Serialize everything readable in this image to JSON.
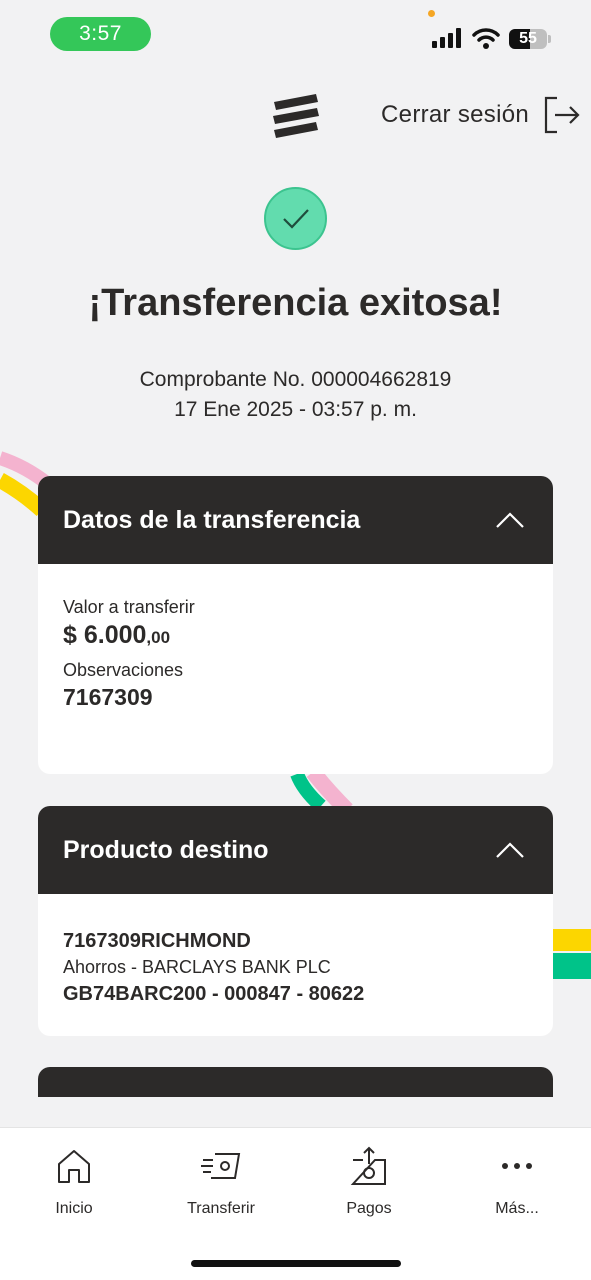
{
  "status_bar": {
    "time": "3:57",
    "battery": "55",
    "battery_fraction": 0.55
  },
  "header": {
    "logout_label": "Cerrar sesión"
  },
  "success": {
    "title": "¡Transferencia exitosa!",
    "voucher": "Comprobante No. 000004662819",
    "datetime": "17 Ene 2025 - 03:57 p. m."
  },
  "transfer_card": {
    "title": "Datos de la transferencia",
    "amount_label": "Valor a transferir",
    "amount_main": "$ 6.000",
    "amount_cents": ",00",
    "notes_label": "Observaciones",
    "notes_value": "7167309"
  },
  "destination_card": {
    "title": "Producto destino",
    "name": "7167309RICHMOND",
    "account_type": "Ahorros - BARCLAYS BANK PLC",
    "account_number": "GB74BARC200 - 000847 - 80622"
  },
  "bottom_nav": {
    "items": [
      {
        "label": "Inicio",
        "icon": "home-icon"
      },
      {
        "label": "Transferir",
        "icon": "transfer-icon"
      },
      {
        "label": "Pagos",
        "icon": "payments-icon"
      },
      {
        "label": "Más...",
        "icon": "more-icon"
      }
    ]
  },
  "colors": {
    "dark": "#2c2a29",
    "success_green": "#62dcae",
    "status_green": "#34c759",
    "stripe_yellow": "#fcd600",
    "stripe_pink": "#f4b3cf",
    "stripe_green": "#00c389"
  }
}
